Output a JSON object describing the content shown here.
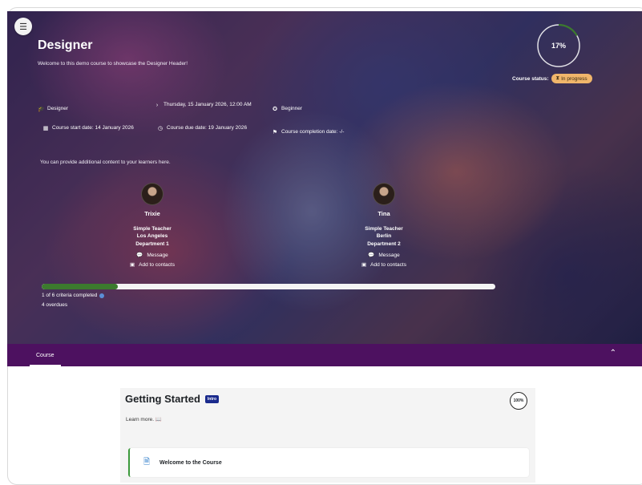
{
  "header": {
    "title": "Designer",
    "subtitle": "Welcome to this demo course to showcase the Designer Header!",
    "progress_percent": "17%",
    "progress_fraction": 0.17,
    "status_label": "Course status:",
    "status_value": "In progress",
    "meta": {
      "category": "Designer",
      "datetime": "Thursday, 15 January 2026, 12:00 AM",
      "level": "Beginner",
      "start_date": "Course start date: 14 January 2026",
      "due_date": "Course due date: 19 January 2026",
      "completion_date": "Course completion date: -/-"
    },
    "additional_content": "You can provide additional content to your learners here.",
    "contacts": [
      {
        "name": "Trixie",
        "role": "Simple Teacher",
        "city": "Los Angeles",
        "department": "Department 1",
        "message_label": "Message",
        "add_contact_label": "Add to contacts"
      },
      {
        "name": "Tina",
        "role": "Simple Teacher",
        "city": "Berlin",
        "department": "Department 2",
        "message_label": "Message",
        "add_contact_label": "Add to contacts"
      }
    ],
    "criteria_progress_fraction": 0.167,
    "criteria_text": "1 of 6 criteria completed",
    "overdues_text": "4 overdues"
  },
  "course_nav": {
    "tab_label": "Course"
  },
  "section": {
    "title": "Getting Started",
    "badge": "Intro",
    "completion": "100%",
    "learn_more": "Learn more. 📖",
    "activity_label": "Welcome to the Course"
  },
  "colors": {
    "accent_purple": "#4d1160",
    "progress_green": "#3c7a2e",
    "status_badge": "#f0b66b",
    "intro_badge": "#1a2a8c"
  }
}
